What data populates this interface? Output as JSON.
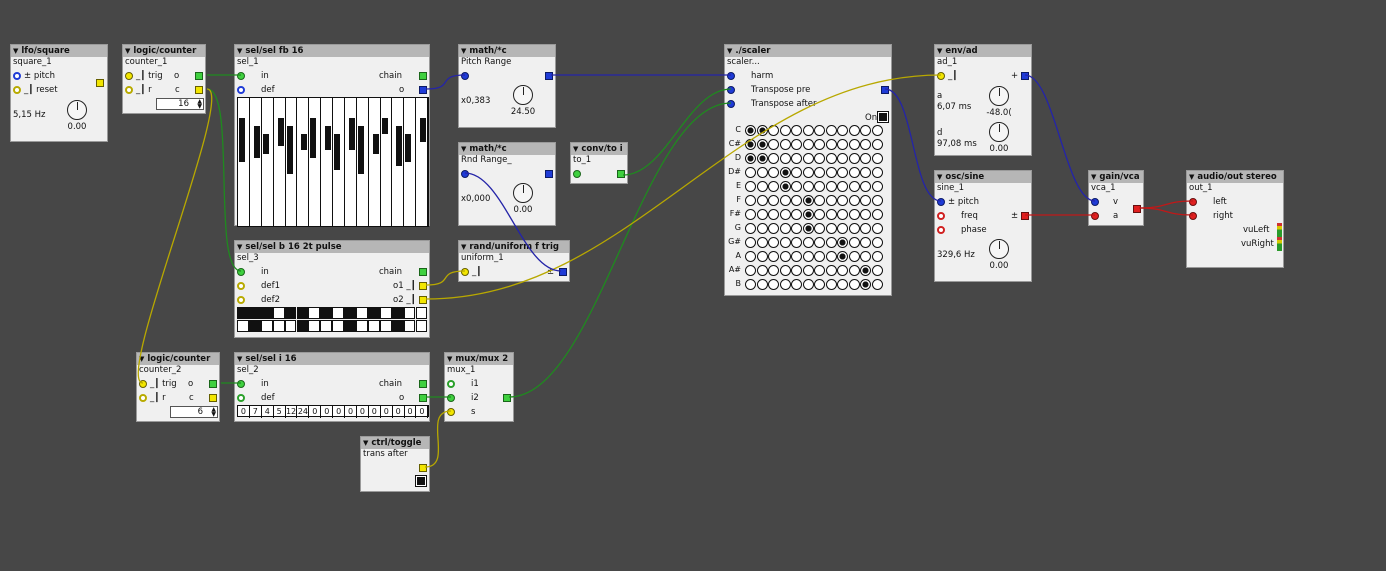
{
  "objects": {
    "lfo": {
      "type": "lfo/square",
      "name": "square_1",
      "in_pitch": "pitch",
      "in_reset": "reset",
      "freq": "5,15 Hz",
      "knob_val": "0.00"
    },
    "counter1": {
      "type": "logic/counter",
      "name": "counter_1",
      "in_trig": "trig",
      "in_r": "r",
      "out_o": "o",
      "out_c": "c",
      "num": "16"
    },
    "selfb": {
      "type": "sel/sel fb 16",
      "name": "sel_1",
      "in_in": "in",
      "in_def": "def",
      "out_chain": "chain",
      "out_o": "o"
    },
    "mathc1": {
      "type": "math/*c",
      "name": "Pitch Range",
      "value": "x0,383",
      "knob_val": "24.50"
    },
    "mathc2": {
      "type": "math/*c",
      "name": "Rnd Range_",
      "value": "x0,000",
      "knob_val": "0.00"
    },
    "convtoi": {
      "type": "conv/to i",
      "name": "to_1"
    },
    "scaler": {
      "type": "./scaler",
      "name": "scaler...",
      "in_harm": "harm",
      "in_tpre": "Transpose pre",
      "in_tafter": "Transpose after",
      "on_label": "On",
      "notes": [
        "C",
        "C#",
        "D",
        "D#",
        "E",
        "F",
        "F#",
        "G",
        "G#",
        "A",
        "A#",
        "B"
      ]
    },
    "envad": {
      "type": "env/ad",
      "name": "ad_1",
      "a_label": "a",
      "a_val": "6,07 ms",
      "a_knob": "-48.0(",
      "d_label": "d",
      "d_val": "97,08 ms",
      "d_knob": "0.00"
    },
    "osc": {
      "type": "osc/sine",
      "name": "sine_1",
      "in_pitch": "pitch",
      "in_freq": "freq",
      "in_phase": "phase",
      "freq_val": "329,6 Hz",
      "knob_val": "0.00"
    },
    "gain": {
      "type": "gain/vca",
      "name": "vca_1",
      "in_v": "v",
      "in_a": "a"
    },
    "audioout": {
      "type": "audio/out stereo",
      "name": "out_1",
      "in_left": "left",
      "in_right": "right",
      "vu_left": "vuLeft",
      "vu_right": "vuRight"
    },
    "selb": {
      "type": "sel/sel b 16 2t pulse",
      "name": "sel_3",
      "in_in": "in",
      "in_def1": "def1",
      "in_def2": "def2",
      "out_chain": "chain",
      "out_o1": "o1",
      "out_o2": "o2"
    },
    "randu": {
      "type": "rand/uniform f trig",
      "name": "uniform_1"
    },
    "counter2": {
      "type": "logic/counter",
      "name": "counter_2",
      "in_trig": "trig",
      "in_r": "r",
      "out_o": "o",
      "out_c": "c",
      "num": "6"
    },
    "seli": {
      "type": "sel/sel i 16",
      "name": "sel_2",
      "in_in": "in",
      "in_def": "def",
      "out_chain": "chain",
      "out_o": "o",
      "values": [
        "0",
        "7",
        "4",
        "5",
        "12",
        "24",
        "0",
        "0",
        "0",
        "0",
        "0",
        "0",
        "0",
        "0",
        "0",
        "0"
      ]
    },
    "mux": {
      "type": "mux/mux 2",
      "name": "mux_1",
      "in_i1": "i1",
      "in_i2": "i2",
      "in_s": "s"
    },
    "toggle": {
      "type": "ctrl/toggle",
      "name": "trans after"
    }
  },
  "glyphs": {
    "plusminus": "±",
    "collapse": "▼",
    "pulse": "_┃"
  },
  "colors": {
    "background": "#474747",
    "wire_blue": "#2424a8",
    "wire_green": "#1f8a1f",
    "wire_yellow": "#b8a800",
    "wire_red": "#c01818"
  },
  "scaler_grid": [
    [
      1,
      1,
      0,
      0,
      0,
      0,
      0,
      0,
      0,
      0,
      0,
      0
    ],
    [
      1,
      1,
      0,
      0,
      0,
      0,
      0,
      0,
      0,
      0,
      0,
      0
    ],
    [
      1,
      1,
      0,
      0,
      0,
      0,
      0,
      0,
      0,
      0,
      0,
      0
    ],
    [
      0,
      0,
      0,
      1,
      0,
      0,
      0,
      0,
      0,
      0,
      0,
      0
    ],
    [
      0,
      0,
      0,
      1,
      0,
      0,
      0,
      0,
      0,
      0,
      0,
      0
    ],
    [
      0,
      0,
      0,
      0,
      0,
      1,
      0,
      0,
      0,
      0,
      0,
      0
    ],
    [
      0,
      0,
      0,
      0,
      0,
      1,
      0,
      0,
      0,
      0,
      0,
      0
    ],
    [
      0,
      0,
      0,
      0,
      0,
      1,
      0,
      0,
      0,
      0,
      0,
      0
    ],
    [
      0,
      0,
      0,
      0,
      0,
      0,
      0,
      0,
      1,
      0,
      0,
      0
    ],
    [
      0,
      0,
      0,
      0,
      0,
      0,
      0,
      0,
      1,
      0,
      0,
      0
    ],
    [
      0,
      0,
      0,
      0,
      0,
      0,
      0,
      0,
      0,
      0,
      1,
      0
    ],
    [
      0,
      0,
      0,
      0,
      0,
      0,
      0,
      0,
      0,
      0,
      1,
      0
    ]
  ],
  "pulse_rows": [
    [
      1,
      1,
      1,
      0,
      1,
      1,
      0,
      1,
      0,
      1,
      0,
      1,
      0,
      1,
      0,
      0
    ],
    [
      0,
      1,
      0,
      0,
      0,
      1,
      0,
      0,
      0,
      1,
      0,
      0,
      0,
      1,
      0,
      0
    ]
  ],
  "fb_bars": [
    0.55,
    0.4,
    0.25,
    0.35,
    0.6,
    0.2,
    0.5,
    0.3,
    0.45,
    0.4,
    0.6,
    0.25,
    0.2,
    0.5,
    0.35,
    0.3
  ]
}
